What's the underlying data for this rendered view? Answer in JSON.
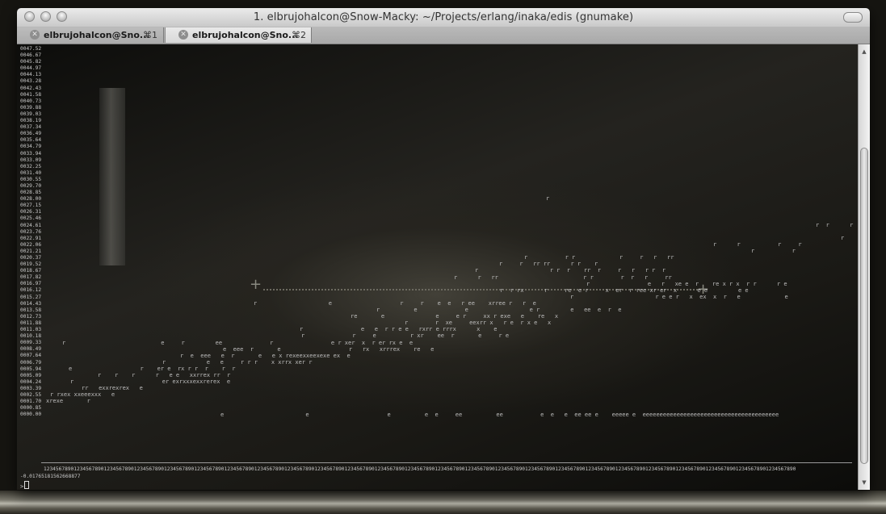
{
  "window": {
    "title": "1. elbrujohalcon@Snow-Macky: ~/Projects/erlang/inaka/edis (gnumake)"
  },
  "tabs": [
    {
      "label": "elbrujohalcon@Sno...",
      "shortcut": "⌘1",
      "active": false
    },
    {
      "label": "elbrujohalcon@Sno...",
      "shortcut": "⌘2",
      "active": true
    }
  ],
  "terminal": {
    "y_labels": [
      "0047.52",
      "0046.67",
      "0045.82",
      "0044.97",
      "0044.13",
      "0043.28",
      "0042.43",
      "0041.58",
      "0040.73",
      "0039.88",
      "0039.03",
      "0038.19",
      "0037.34",
      "0036.49",
      "0035.64",
      "0034.79",
      "0033.94",
      "0033.09",
      "0032.25",
      "0031.40",
      "0030.55",
      "0029.70",
      "0028.85",
      "0028.00",
      "0027.15",
      "0026.31",
      "0025.46",
      "0024.61",
      "0023.76",
      "0022.91",
      "0022.06",
      "0021.21",
      "0020.37",
      "0019.52",
      "0018.67",
      "0017.82",
      "0016.97",
      "0016.12",
      "0015.27",
      "0014.43",
      "0013.58",
      "0012.73",
      "0011.88",
      "0011.03",
      "0010.18",
      "0009.33",
      "0008.49",
      "0007.64",
      "0006.79",
      "0005.94",
      "0005.09",
      "0004.24",
      "0003.39",
      "0002.55",
      "0001.70",
      "0000.85",
      "0000.00"
    ],
    "row_texts": {
      "23": "r",
      "27": "r  r      r",
      "29": "r                r",
      "30": "r      r           r     r",
      "31": "r           r",
      "32": "r           r r             r     r   r   rr",
      "33": "r     r   rr rr      r r    r",
      "34": "r                     r r  r    rr  r     r   r   r r  r",
      "35": "r      r   rr                         r r        r  r   r     rr",
      "36": "r                 e   r   xe e  r    re x r x  r r      r e",
      "37": "r  r rx      r     re  e r     x  er  r ree xr er  x      e e         e e",
      "38": "r                        r e e r   x  ex  x  r   e             e",
      "39": "r                     e                    r     r    e  e   r ee    xrree r   r  e",
      "40": "r          e              e                  e r         e   ee  e  r  e",
      "41": "re       e               e     e r     xx r exe   e    re   x",
      "42": "r        r  xe     eexrr x   r e  r x e   x",
      "43": "r                 e   e  r r e e   rxrr e rrrx      x    e",
      "44": "r              r     e          r xr    ee  r       e     r e",
      "45": "r                            e     r         ee              r                 e r xer  x  r er rx e  e",
      "46": "e  eee  r       e                    r   rx   xrrrex    re   e",
      "47": "r  e  eee   e  r       e   e x rexeexxeexexe ex  e",
      "48": "r            e   e     r r r    x xrrx xer r",
      "49": "e                    r    er e  rx r r  r    r  r",
      "50": "r    r    r      r   e e   xxrrex rr  r",
      "51": "r                          er exrxxxexxrerex  e",
      "52": "rr   exxrexrex   e",
      "53": "r rxex xxeeexxx   e",
      "54": "xrexe       r",
      "56": "e                        e                       e          e  e     ee          ee           e  e   e  ee ee e    eeeee e  eeeeeeeeeeeeeeeeeeeeeeeeeeeeeeeeeeeeeeee"
    },
    "x_digits": "1234567890123456789012345678901234567890123456789012345678901234567890123456789012345678901234567890123456789012345678901234567890123456789012345678901234567890123456789012345678901234567890123456789012345678901234567890123456789012345678901234567890",
    "value_line": "-0.01765181562668877",
    "prompt": ">"
  }
}
